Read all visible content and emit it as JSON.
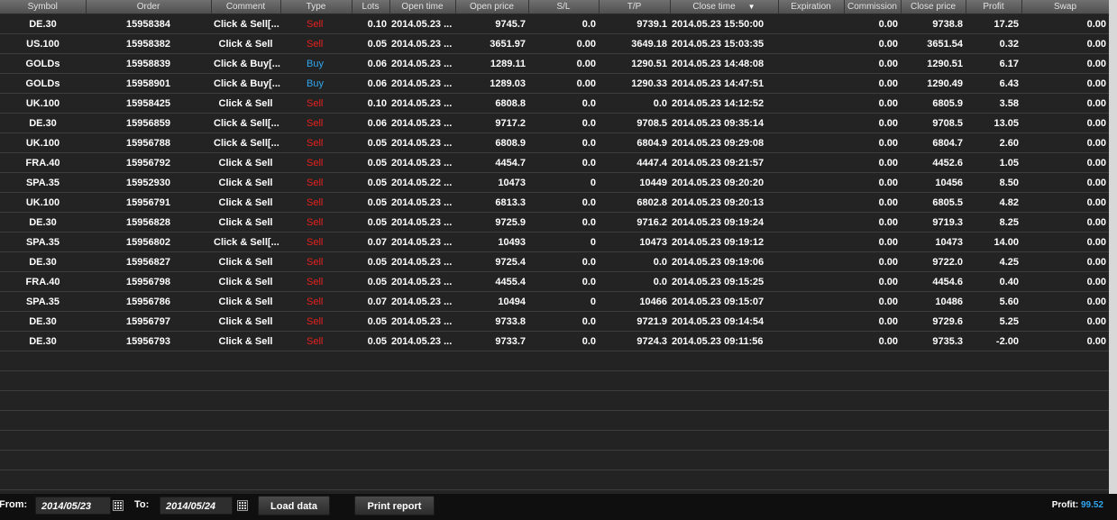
{
  "columns": {
    "symbol": "Symbol",
    "order": "Order",
    "comment": "Comment",
    "type": "Type",
    "lots": "Lots",
    "open_time": "Open time",
    "open_price": "Open price",
    "sl": "S/L",
    "tp": "T/P",
    "close_time": "Close time",
    "expiration": "Expiration",
    "commission": "Commission",
    "close_price": "Close price",
    "profit": "Profit",
    "swap": "Swap"
  },
  "sort_icon": "sort-descending-icon",
  "colors": {
    "sell": "#e8201e",
    "buy": "#2fa6ee",
    "profit_total": "#2fa6ee"
  },
  "rows": [
    {
      "symbol": "DE.30",
      "order": "15958384",
      "comment": "Click & Sell[...",
      "type": "Sell",
      "lots": "0.10",
      "open_time": "2014.05.23 ...",
      "open_price": "9745.7",
      "sl": "0.0",
      "tp": "9739.1",
      "close_time": "2014.05.23 15:50:00",
      "expiration": "",
      "commission": "0.00",
      "close_price": "9738.8",
      "profit": "17.25",
      "swap": "0.00"
    },
    {
      "symbol": "US.100",
      "order": "15958382",
      "comment": "Click & Sell",
      "type": "Sell",
      "lots": "0.05",
      "open_time": "2014.05.23 ...",
      "open_price": "3651.97",
      "sl": "0.00",
      "tp": "3649.18",
      "close_time": "2014.05.23 15:03:35",
      "expiration": "",
      "commission": "0.00",
      "close_price": "3651.54",
      "profit": "0.32",
      "swap": "0.00"
    },
    {
      "symbol": "GOLDs",
      "order": "15958839",
      "comment": "Click & Buy[...",
      "type": "Buy",
      "lots": "0.06",
      "open_time": "2014.05.23 ...",
      "open_price": "1289.11",
      "sl": "0.00",
      "tp": "1290.51",
      "close_time": "2014.05.23 14:48:08",
      "expiration": "",
      "commission": "0.00",
      "close_price": "1290.51",
      "profit": "6.17",
      "swap": "0.00"
    },
    {
      "symbol": "GOLDs",
      "order": "15958901",
      "comment": "Click & Buy[...",
      "type": "Buy",
      "lots": "0.06",
      "open_time": "2014.05.23 ...",
      "open_price": "1289.03",
      "sl": "0.00",
      "tp": "1290.33",
      "close_time": "2014.05.23 14:47:51",
      "expiration": "",
      "commission": "0.00",
      "close_price": "1290.49",
      "profit": "6.43",
      "swap": "0.00"
    },
    {
      "symbol": "UK.100",
      "order": "15958425",
      "comment": "Click & Sell",
      "type": "Sell",
      "lots": "0.10",
      "open_time": "2014.05.23 ...",
      "open_price": "6808.8",
      "sl": "0.0",
      "tp": "0.0",
      "close_time": "2014.05.23 14:12:52",
      "expiration": "",
      "commission": "0.00",
      "close_price": "6805.9",
      "profit": "3.58",
      "swap": "0.00"
    },
    {
      "symbol": "DE.30",
      "order": "15956859",
      "comment": "Click & Sell[...",
      "type": "Sell",
      "lots": "0.06",
      "open_time": "2014.05.23 ...",
      "open_price": "9717.2",
      "sl": "0.0",
      "tp": "9708.5",
      "close_time": "2014.05.23 09:35:14",
      "expiration": "",
      "commission": "0.00",
      "close_price": "9708.5",
      "profit": "13.05",
      "swap": "0.00"
    },
    {
      "symbol": "UK.100",
      "order": "15956788",
      "comment": "Click & Sell[...",
      "type": "Sell",
      "lots": "0.05",
      "open_time": "2014.05.23 ...",
      "open_price": "6808.9",
      "sl": "0.0",
      "tp": "6804.9",
      "close_time": "2014.05.23 09:29:08",
      "expiration": "",
      "commission": "0.00",
      "close_price": "6804.7",
      "profit": "2.60",
      "swap": "0.00"
    },
    {
      "symbol": "FRA.40",
      "order": "15956792",
      "comment": "Click & Sell",
      "type": "Sell",
      "lots": "0.05",
      "open_time": "2014.05.23 ...",
      "open_price": "4454.7",
      "sl": "0.0",
      "tp": "4447.4",
      "close_time": "2014.05.23 09:21:57",
      "expiration": "",
      "commission": "0.00",
      "close_price": "4452.6",
      "profit": "1.05",
      "swap": "0.00"
    },
    {
      "symbol": "SPA.35",
      "order": "15952930",
      "comment": "Click & Sell",
      "type": "Sell",
      "lots": "0.05",
      "open_time": "2014.05.22 ...",
      "open_price": "10473",
      "sl": "0",
      "tp": "10449",
      "close_time": "2014.05.23 09:20:20",
      "expiration": "",
      "commission": "0.00",
      "close_price": "10456",
      "profit": "8.50",
      "swap": "0.00"
    },
    {
      "symbol": "UK.100",
      "order": "15956791",
      "comment": "Click & Sell",
      "type": "Sell",
      "lots": "0.05",
      "open_time": "2014.05.23 ...",
      "open_price": "6813.3",
      "sl": "0.0",
      "tp": "6802.8",
      "close_time": "2014.05.23 09:20:13",
      "expiration": "",
      "commission": "0.00",
      "close_price": "6805.5",
      "profit": "4.82",
      "swap": "0.00"
    },
    {
      "symbol": "DE.30",
      "order": "15956828",
      "comment": "Click & Sell",
      "type": "Sell",
      "lots": "0.05",
      "open_time": "2014.05.23 ...",
      "open_price": "9725.9",
      "sl": "0.0",
      "tp": "9716.2",
      "close_time": "2014.05.23 09:19:24",
      "expiration": "",
      "commission": "0.00",
      "close_price": "9719.3",
      "profit": "8.25",
      "swap": "0.00"
    },
    {
      "symbol": "SPA.35",
      "order": "15956802",
      "comment": "Click & Sell[...",
      "type": "Sell",
      "lots": "0.07",
      "open_time": "2014.05.23 ...",
      "open_price": "10493",
      "sl": "0",
      "tp": "10473",
      "close_time": "2014.05.23 09:19:12",
      "expiration": "",
      "commission": "0.00",
      "close_price": "10473",
      "profit": "14.00",
      "swap": "0.00"
    },
    {
      "symbol": "DE.30",
      "order": "15956827",
      "comment": "Click & Sell",
      "type": "Sell",
      "lots": "0.05",
      "open_time": "2014.05.23 ...",
      "open_price": "9725.4",
      "sl": "0.0",
      "tp": "0.0",
      "close_time": "2014.05.23 09:19:06",
      "expiration": "",
      "commission": "0.00",
      "close_price": "9722.0",
      "profit": "4.25",
      "swap": "0.00"
    },
    {
      "symbol": "FRA.40",
      "order": "15956798",
      "comment": "Click & Sell",
      "type": "Sell",
      "lots": "0.05",
      "open_time": "2014.05.23 ...",
      "open_price": "4455.4",
      "sl": "0.0",
      "tp": "0.0",
      "close_time": "2014.05.23 09:15:25",
      "expiration": "",
      "commission": "0.00",
      "close_price": "4454.6",
      "profit": "0.40",
      "swap": "0.00"
    },
    {
      "symbol": "SPA.35",
      "order": "15956786",
      "comment": "Click & Sell",
      "type": "Sell",
      "lots": "0.07",
      "open_time": "2014.05.23 ...",
      "open_price": "10494",
      "sl": "0",
      "tp": "10466",
      "close_time": "2014.05.23 09:15:07",
      "expiration": "",
      "commission": "0.00",
      "close_price": "10486",
      "profit": "5.60",
      "swap": "0.00"
    },
    {
      "symbol": "DE.30",
      "order": "15956797",
      "comment": "Click & Sell",
      "type": "Sell",
      "lots": "0.05",
      "open_time": "2014.05.23 ...",
      "open_price": "9733.8",
      "sl": "0.0",
      "tp": "9721.9",
      "close_time": "2014.05.23 09:14:54",
      "expiration": "",
      "commission": "0.00",
      "close_price": "9729.6",
      "profit": "5.25",
      "swap": "0.00"
    },
    {
      "symbol": "DE.30",
      "order": "15956793",
      "comment": "Click & Sell",
      "type": "Sell",
      "lots": "0.05",
      "open_time": "2014.05.23 ...",
      "open_price": "9733.7",
      "sl": "0.0",
      "tp": "9724.3",
      "close_time": "2014.05.23 09:11:56",
      "expiration": "",
      "commission": "0.00",
      "close_price": "9735.3",
      "profit": "-2.00",
      "swap": "0.00"
    }
  ],
  "footer": {
    "from_label": "From:",
    "from_date": "2014/05/23",
    "to_label": "To:",
    "to_date": "2014/05/24",
    "calendar_icon": "calendar-icon",
    "load_button": "Load data",
    "print_button": "Print report",
    "profit_label": "Profit:",
    "profit_value": "99.52"
  }
}
